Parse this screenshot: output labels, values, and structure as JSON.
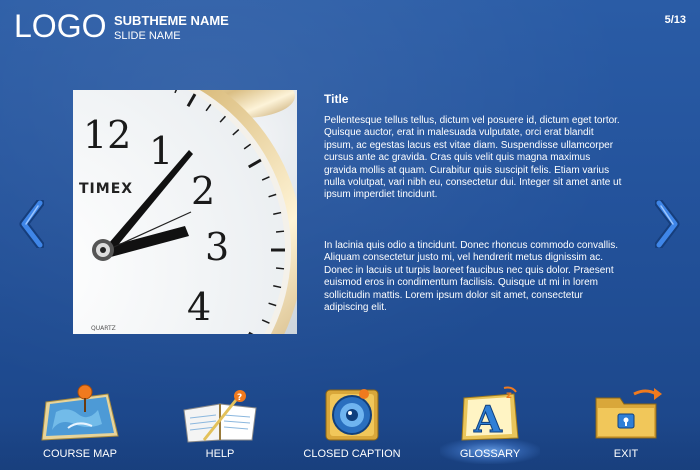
{
  "header": {
    "logo": "LOGO",
    "subtheme": "SUBTHEME NAME",
    "slide_name": "SLIDE NAME",
    "page_count": "5/13"
  },
  "content": {
    "title": "Title",
    "paragraph1": "Pellentesque tellus tellus, dictum vel posuere id, dictum eget tortor. Quisque auctor, erat in malesuada vulputate, orci erat blandit ipsum, ac egestas lacus est vitae diam. Suspendisse ullamcorper cursus ante ac gravida. Cras quis velit quis magna maximus gravida mollis at quam. Curabitur quis suscipit felis. Etiam varius nulla volutpat, vari nibh eu, consectetur dui. Integer sit amet ante ut ipsum imperdiet tincidunt.",
    "paragraph2": "In lacinia quis odio a tincidunt. Donec rhoncus commodo convallis. Aliquam consectetur justo mi, vel hendrerit metus dignissim ac. Donec in lacuis ut turpis laoreet faucibus nec quis dolor. Praesent euismod eros in condimentum facilisis. Quisque ut mi in lorem sollicitudin mattis. Lorem ipsum dolor sit amet, consectetur adipiscing elit.",
    "clock_brand": "TIMEX",
    "clock_quartz": "QUARTZ",
    "clock_numerals": [
      "12",
      "1",
      "2",
      "3",
      "4"
    ]
  },
  "menu": {
    "course_map": "COURSE MAP",
    "help": "HELP",
    "closed_caption": "CLOSED CAPTION",
    "glossary": "GLOSSARY",
    "exit": "EXIT",
    "active": "glossary"
  },
  "colors": {
    "background": "#23529b",
    "arrow": "#2f6fd0",
    "glow": "#78b4ff"
  }
}
